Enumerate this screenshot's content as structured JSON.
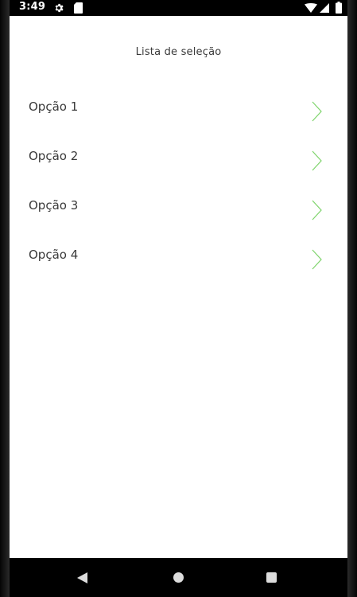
{
  "status_bar": {
    "time": "3:49",
    "icons": [
      "settings-icon",
      "sd-card-icon",
      "wifi-icon",
      "signal-icon",
      "battery-icon"
    ]
  },
  "page": {
    "title": "Lista de seleção"
  },
  "list": {
    "items": [
      {
        "label": "Opção 1"
      },
      {
        "label": "Opção 2"
      },
      {
        "label": "Opção 3"
      },
      {
        "label": "Opção 4"
      }
    ]
  },
  "nav_bar": {
    "buttons": [
      "back",
      "home",
      "recents"
    ]
  },
  "colors": {
    "accent": "#7ed46b",
    "text": "#3a3a3a",
    "background": "#ffffff"
  }
}
